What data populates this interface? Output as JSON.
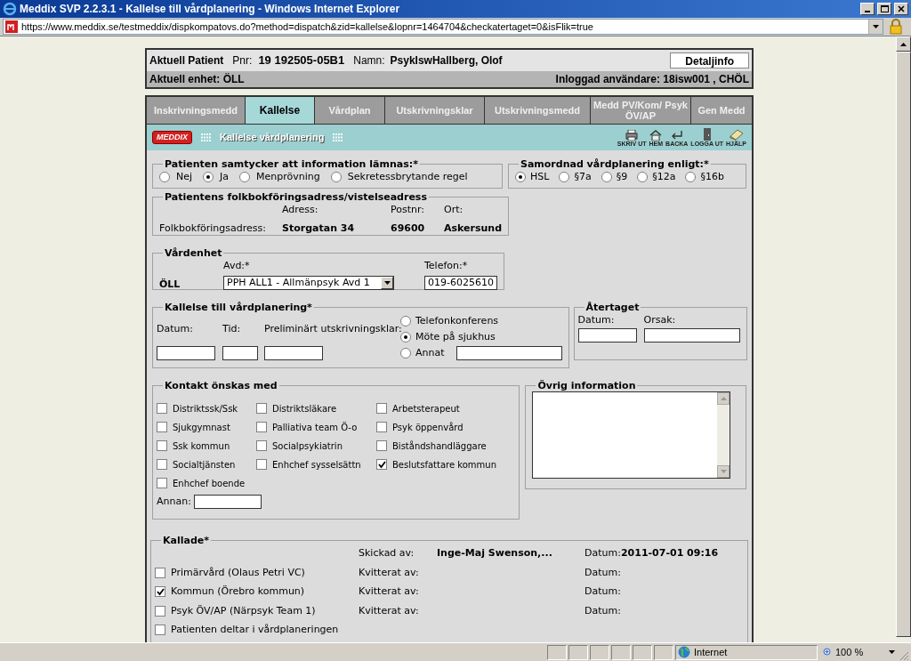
{
  "window": {
    "title": "Meddix SVP 2.2.3.1 - Kallelse till vårdplanering - Windows Internet Explorer",
    "url": "https://www.meddix.se/testmeddix/dispkompatovs.do?method=dispatch&zid=kallelse&lopnr=1464704&checkatertaget=0&isFlik=true"
  },
  "header": {
    "patient_label": "Aktuell Patient",
    "pnr_label": "Pnr:",
    "pnr": "19 192505-05B1",
    "namn_label": "Namn:",
    "namn": "PsykIswHallberg, Olof",
    "detail_button": "Detaljinfo",
    "unit": "Aktuell enhet: ÖLL",
    "user": "Inloggad användare: 18isw001 , CHÖL"
  },
  "tabs": [
    {
      "label": "Inskrivningsmedd",
      "selected": false
    },
    {
      "label": "Kallelse",
      "selected": true
    },
    {
      "label": "Vårdplan",
      "selected": false
    },
    {
      "label": "Utskrivningsklar",
      "selected": false
    },
    {
      "label": "Utskrivningsmedd",
      "selected": false
    },
    {
      "label": "Medd PV/Kom/ Psyk ÖV/AP",
      "selected": false
    },
    {
      "label": "Gen Medd",
      "selected": false
    }
  ],
  "toolbar": {
    "logo": "MEDDIX",
    "title": "Kallelse vårdplanering",
    "actions": [
      {
        "kind": "print",
        "label": "SKRIV UT"
      },
      {
        "kind": "home",
        "label": "HEM"
      },
      {
        "kind": "back",
        "label": "BACKA"
      },
      {
        "kind": "logout",
        "label": "LOGGA UT"
      },
      {
        "kind": "help",
        "label": "HJÄLP"
      }
    ]
  },
  "consent": {
    "legend": "Patienten samtycker att information lämnas:*",
    "options": [
      {
        "label": "Nej",
        "selected": false
      },
      {
        "label": "Ja",
        "selected": true
      },
      {
        "label": "Menprövning",
        "selected": false
      },
      {
        "label": "Sekretessbrytande regel",
        "selected": false
      }
    ]
  },
  "samordnad": {
    "legend": "Samordnad vårdplanering enligt:*",
    "options": [
      {
        "label": "HSL",
        "selected": true
      },
      {
        "label": "§7a",
        "selected": false
      },
      {
        "label": "§9",
        "selected": false
      },
      {
        "label": "§12a",
        "selected": false
      },
      {
        "label": "§16b",
        "selected": false
      }
    ]
  },
  "address": {
    "legend": "Patientens folkbokföringsadress/vistelseadress",
    "row_label": "Folkbokföringsadress:",
    "columns": [
      {
        "label": "Adress:",
        "value": "Storgatan 34"
      },
      {
        "label": "Postnr:",
        "value": "69600"
      },
      {
        "label": "Ort:",
        "value": "Askersund"
      }
    ]
  },
  "vardenhet": {
    "legend": "Vårdenhet",
    "unit": "ÖLL",
    "avd_label": "Avd:*",
    "avd_value": "PPH ALL1 - Allmänpsyk Avd 1",
    "telefon_label": "Telefon:*",
    "telefon_value": "019-6025610"
  },
  "kallelse": {
    "legend": "Kallelse till vårdplanering*",
    "datum_label": "Datum:",
    "tid_label": "Tid:",
    "prelim_label": "Preliminärt utskrivningsklar:",
    "options": [
      {
        "label": "Telefonkonferens",
        "selected": false
      },
      {
        "label": "Möte på sjukhus",
        "selected": true
      },
      {
        "label": "Annat",
        "selected": false,
        "kind": "with_field"
      }
    ]
  },
  "atertaget": {
    "legend": "Återtaget",
    "datum_label": "Datum:",
    "orsak_label": "Orsak:"
  },
  "kontakt": {
    "legend": "Kontakt önskas med",
    "items": [
      {
        "label": "Distriktssk/Ssk",
        "checked": false
      },
      {
        "label": "Distriktsläkare",
        "checked": false
      },
      {
        "label": "Arbetsterapeut",
        "checked": false
      },
      {
        "label": "Sjukgymnast",
        "checked": false
      },
      {
        "label": "Palliativa team Ö-o",
        "checked": false
      },
      {
        "label": "Psyk öppenvård",
        "checked": false
      },
      {
        "label": "Ssk kommun",
        "checked": false
      },
      {
        "label": "Socialpsykiatrin",
        "checked": false
      },
      {
        "label": "Biståndshandläggare",
        "checked": false
      },
      {
        "label": "Socialtjänsten",
        "checked": false
      },
      {
        "label": "Enhchef sysselsättn",
        "checked": false
      },
      {
        "label": "Beslutsfattare kommun",
        "checked": true
      },
      {
        "label": "Enhchef boende",
        "checked": false
      }
    ],
    "annan_label": "Annan:"
  },
  "ovrig": {
    "legend": "Övrig information"
  },
  "kallade": {
    "legend": "Kallade*",
    "skickad_label": "Skickad av:",
    "skickad_value": "Inge-Maj Swenson,...",
    "datum_label": "Datum:",
    "datum_value": "2011-07-01 09:16",
    "rows": [
      {
        "label": "Primärvård (Olaus Petri VC)",
        "checked": false,
        "kvitterat_label": "Kvitterat av:",
        "datum_label": "Datum:"
      },
      {
        "label": "Kommun (Örebro kommun)",
        "checked": true,
        "kvitterat_label": "Kvitterat av:",
        "datum_label": "Datum:"
      },
      {
        "label": "Psyk ÖV/AP (Närpsyk Team 1)",
        "checked": false,
        "kvitterat_label": "Kvitterat av:",
        "datum_label": "Datum:"
      },
      {
        "label": "Patienten deltar i vårdplaneringen",
        "checked": false
      }
    ]
  },
  "status_bar": {
    "zone": "Internet",
    "zoom": "100 %"
  }
}
